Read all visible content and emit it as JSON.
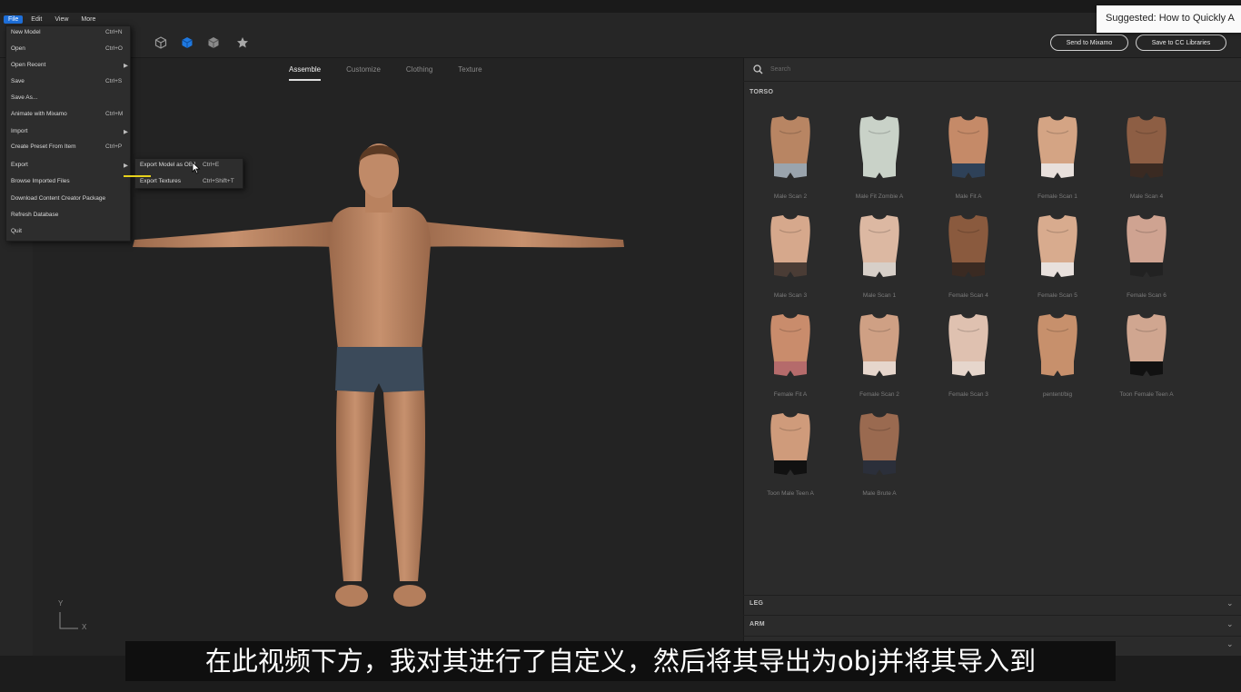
{
  "menubar": {
    "items": [
      "File",
      "Edit",
      "View",
      "More"
    ]
  },
  "suggested": "Suggested: How to Quickly A",
  "toolbar": {
    "send_label": "Send to Mixamo",
    "save_cc_label": "Save to CC Libraries"
  },
  "tabs": [
    "Assemble",
    "Customize",
    "Clothing",
    "Texture"
  ],
  "axis": {
    "y": "Y",
    "x": "X"
  },
  "panel": {
    "search_placeholder": "Search",
    "sections": {
      "torso": "TORSO",
      "leg": "LEG",
      "arm": "ARM"
    },
    "items": [
      "Male Scan 2",
      "Male Fit Zombie A",
      "Male Fit A",
      "Female Scan 1",
      "Male Scan 4",
      "Male Scan 3",
      "Male Scan 1",
      "Female Scan 4",
      "Female Scan 5",
      "Female Scan 6",
      "Female Fit A",
      "Female Scan 2",
      "Female Scan 3",
      "pentent/big",
      "Toon Female Teen A",
      "Toon Male Teen A",
      "Male Brute A"
    ]
  },
  "file_menu": {
    "items": [
      {
        "label": "New Model",
        "shortcut": "Ctrl+N"
      },
      {
        "label": "Open",
        "shortcut": "Ctrl+O"
      },
      {
        "label": "Open Recent",
        "shortcut": "▶"
      },
      {
        "label": "Save",
        "shortcut": "Ctrl+S"
      },
      {
        "label": "Save As...",
        "shortcut": ""
      },
      {
        "label": "Animate with Mixamo",
        "shortcut": "Ctrl+M"
      },
      {
        "label": "Import",
        "shortcut": "▶"
      },
      {
        "label": "Create Preset From Item",
        "shortcut": "Ctrl+P"
      },
      {
        "label": "Export",
        "shortcut": "▶"
      },
      {
        "label": "Browse Imported Files",
        "shortcut": ""
      },
      {
        "label": "Download Content Creator Package",
        "shortcut": ""
      },
      {
        "label": "Refresh Database",
        "shortcut": ""
      },
      {
        "label": "Quit",
        "shortcut": ""
      }
    ]
  },
  "export_submenu": {
    "items": [
      {
        "label": "Export Model as OBJ",
        "shortcut": "Ctrl+E"
      },
      {
        "label": "Export Textures",
        "shortcut": "Ctrl+Shift+T"
      }
    ]
  },
  "subtitle": "在此视频下方，我对其进行了自定义，然后将其导出为obj并将其导入到",
  "colors": {
    "accent": "#1e6fd9",
    "skin": "#c08a68",
    "shorts": "#3b4a5a"
  }
}
